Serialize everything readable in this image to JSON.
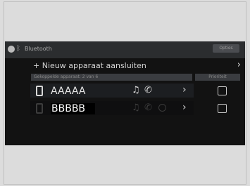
{
  "header": {
    "title": "Bluetooth",
    "options_label": "Opties"
  },
  "add_device": {
    "label": "+ Nieuw apparaat aansluiten",
    "chevron": "›"
  },
  "list": {
    "section_label": "Gekoppelde apparaat: 2 van 6",
    "priority_label": "Prioriteit",
    "devices": [
      {
        "name": "AAAAA",
        "icons": [
          "music-icon",
          "phone-call-icon"
        ],
        "chevron": "›",
        "priority_checked": false
      },
      {
        "name": "BBBBB",
        "icons": [
          "music-icon",
          "phone-call-icon",
          "media-icon"
        ],
        "chevron": "›",
        "priority_checked": false
      }
    ]
  },
  "icons": {
    "bluetooth": "ᛒ",
    "music": "♫",
    "call": "✆"
  }
}
